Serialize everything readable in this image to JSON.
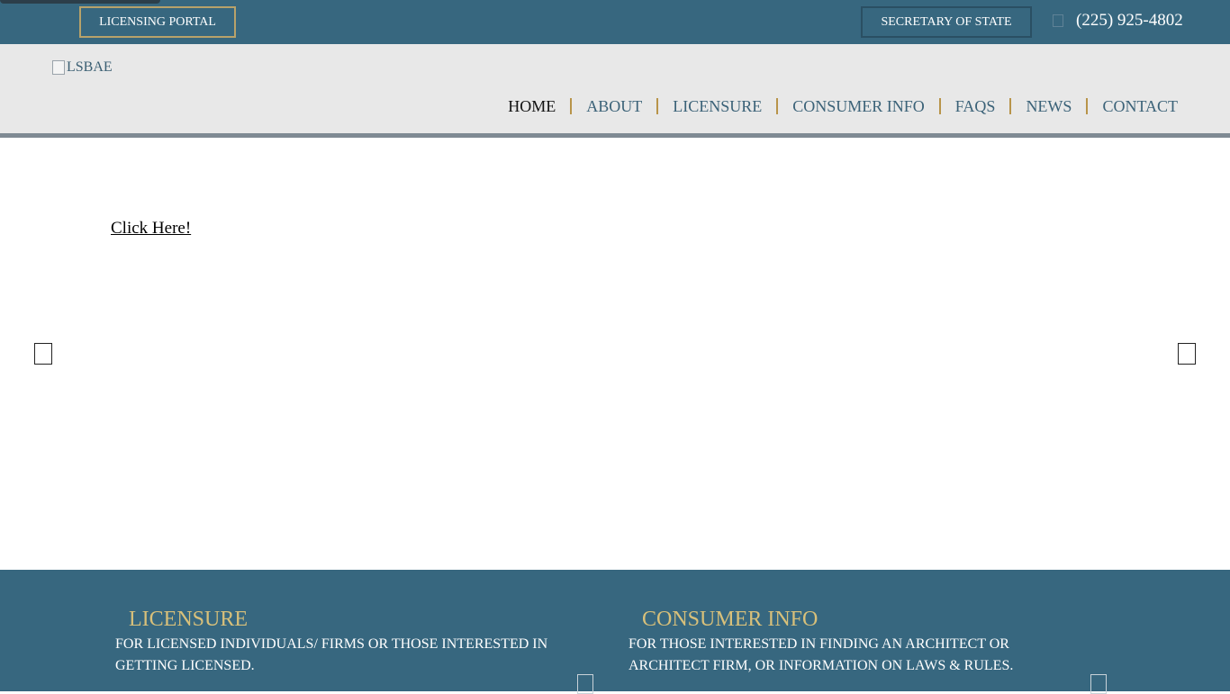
{
  "topbar": {
    "portal_label": "LICENSING PORTAL",
    "sos_label": "SECRETARY OF STATE",
    "phone": "(225) 925-4802",
    "phone_icon": "phone-icon"
  },
  "header": {
    "logo_alt": "LSBAE",
    "nav": [
      {
        "label": "HOME",
        "active": true
      },
      {
        "label": "ABOUT"
      },
      {
        "label": "LICENSURE"
      },
      {
        "label": "CONSUMER INFO"
      },
      {
        "label": "FAQS"
      },
      {
        "label": "NEWS"
      },
      {
        "label": "CONTACT"
      }
    ]
  },
  "hero": {
    "link_text": "Click Here!",
    "prev_icon": "chevron-left-icon",
    "next_icon": "chevron-right-icon"
  },
  "footer": {
    "cards": [
      {
        "title": "LICENSURE",
        "description": "FOR LICENSED INDIVIDUALS/ FIRMS OR THOSE INTERESTED IN GETTING LICENSED."
      },
      {
        "title": "CONSUMER INFO",
        "description": "FOR THOSE INTERESTED IN FINDING AN ARCHITECT OR ARCHITECT FIRM, OR INFORMATION ON LAWS & RULES."
      }
    ]
  },
  "colors": {
    "topbar_bg": "#37677f",
    "header_bg": "#e8e8e8",
    "accent_gold": "#b8944a",
    "card_title": "#d8c07a",
    "nav_text": "#3b6278"
  }
}
